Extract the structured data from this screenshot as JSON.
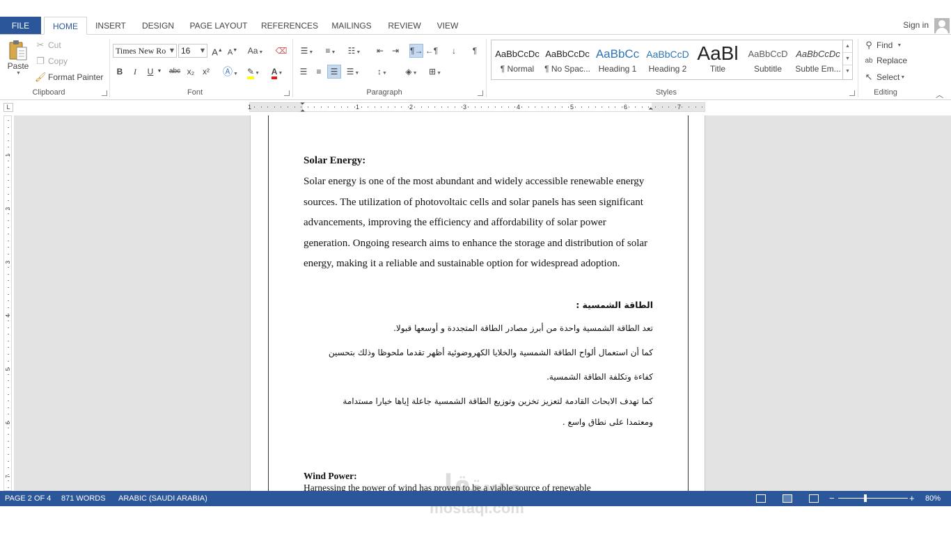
{
  "tabs": {
    "file": "FILE",
    "items": [
      "HOME",
      "INSERT",
      "DESIGN",
      "PAGE LAYOUT",
      "REFERENCES",
      "MAILINGS",
      "REVIEW",
      "VIEW"
    ],
    "signin": "Sign in"
  },
  "clipboard": {
    "paste": "Paste",
    "cut": "Cut",
    "copy": "Copy",
    "format_painter": "Format Painter",
    "label": "Clipboard"
  },
  "font": {
    "name": "Times New Ro",
    "size": "16",
    "label": "Font",
    "bold": "B",
    "italic": "I",
    "underline": "U",
    "strike": "abc",
    "subscript": "x₂",
    "superscript": "x²",
    "grow": "A",
    "shrink": "A",
    "case": "Aa"
  },
  "paragraph": {
    "label": "Paragraph"
  },
  "styles": {
    "label": "Styles",
    "items": [
      {
        "preview": "AaBbCcDc",
        "label": "¶ Normal"
      },
      {
        "preview": "AaBbCcDc",
        "label": "¶ No Spac..."
      },
      {
        "preview": "AaBbCc",
        "label": "Heading 1"
      },
      {
        "preview": "AaBbCcD",
        "label": "Heading 2"
      },
      {
        "preview": "AaBl",
        "label": "Title"
      },
      {
        "preview": "AaBbCcD",
        "label": "Subtitle"
      },
      {
        "preview": "AaBbCcDc",
        "label": "Subtle Em..."
      }
    ]
  },
  "editing": {
    "find": "Find",
    "replace": "Replace",
    "select": "Select",
    "label": "Editing"
  },
  "ruler": {
    "corner": "L",
    "numbers": [
      "1",
      "1",
      "2",
      "3",
      "4",
      "5",
      "6",
      "7"
    ]
  },
  "vruler": {
    "numbers": [
      "1",
      "2",
      "3",
      "4",
      "5",
      "6",
      "7"
    ]
  },
  "document": {
    "solar_heading": "Solar Energy:",
    "solar_paragraph": "Solar energy is one of the most abundant and widely accessible renewable energy sources. The utilization of photovoltaic cells and solar panels has seen significant advancements, improving the efficiency and affordability of solar power generation. Ongoing research aims to enhance the storage and distribution of solar energy, making it a reliable and sustainable option for widespread adoption.",
    "arabic_heading": "الطاقة الشمسية :",
    "arabic_lines": [
      "تعد الطاقة الشمسية واحدة من أبرز مصادر الطاقة المتجددة و أوسعها قبولا.",
      "كما أن استعمال ألواح الطاقة الشمسية والخلايا الكهروضوئية أظهر تقدما ملحوظا وذلك بتحسين",
      "كفاءة وتكلفة الطاقة الشمسية.",
      "كما تهدف الابحاث القادمة لتعزيز تخزين وتوزيع الطاقة الشمسية جاعلة إياها خيارا مستدامة",
      "ومعتمدا على نطاق واسع ."
    ],
    "wind_heading": "Wind Power:",
    "wind_line": "Harnessing the power of wind has proven to be a viable source of renewable"
  },
  "status": {
    "page": "PAGE 2 OF 4",
    "words": "871 WORDS",
    "language": "ARABIC (SAUDI ARABIA)",
    "zoom": "80%",
    "minus": "−",
    "plus": "+"
  },
  "watermark": {
    "arabic": "مستقل",
    "latin": "mostaql.com"
  }
}
